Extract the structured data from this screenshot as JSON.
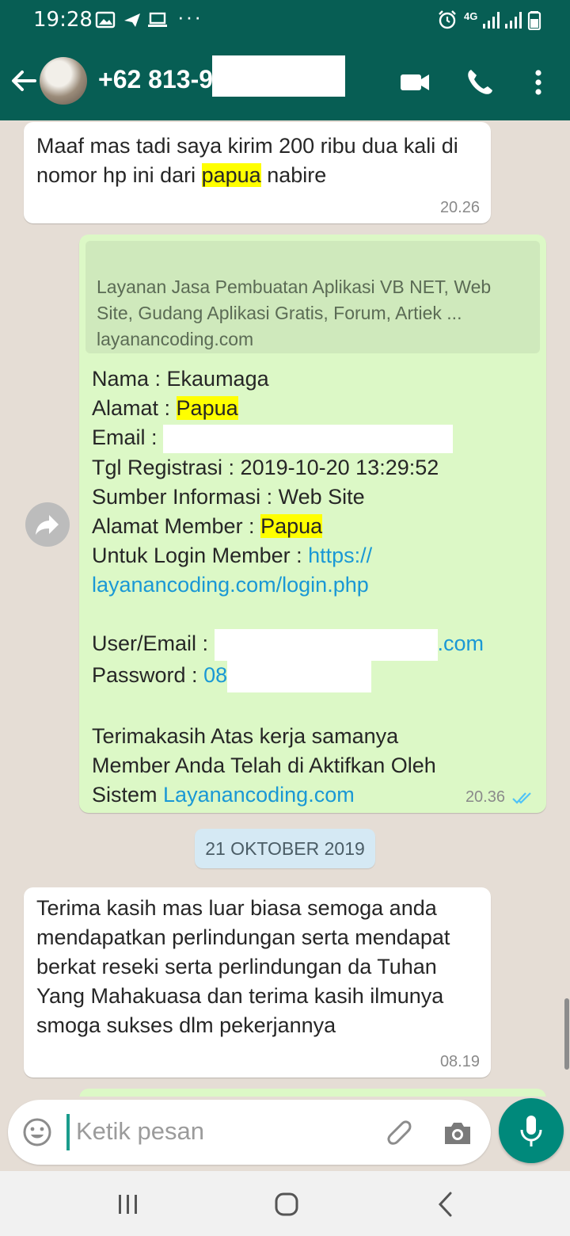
{
  "status_bar": {
    "time": "19:28",
    "more": "···",
    "network": "4G"
  },
  "header": {
    "contact_visible": "+62 813-9",
    "icons": [
      "back-arrow-icon",
      "video-call-icon",
      "voice-call-icon",
      "menu-dots-icon"
    ]
  },
  "messages": [
    {
      "direction": "in",
      "text_pre": "Maaf  mas tadi saya kirim 200 ribu dua kali di nomor hp ini dari ",
      "highlight": "papua",
      "text_post": " nabire",
      "time": "20.26"
    },
    {
      "direction": "out",
      "preview": {
        "title": "Layanan Jasa Pembuatan Aplikasi VB NET, Web Site, Gudang Aplikasi Gratis, Forum, Artiek ...",
        "domain": "layanancoding.com"
      },
      "lines": {
        "nama": "Nama : Ekaumaga",
        "alamat_label": "Alamat : ",
        "alamat_value": "Papua",
        "email_label": "Email : ",
        "tgl": "Tgl Registrasi : 2019-10-20 13:29:52",
        "sumber": "Sumber Informasi : Web Site",
        "alamat_member_label": "Alamat Member : ",
        "alamat_member_value": "Papua",
        "login_label": "Untuk Login Member : ",
        "login_link_1": "https://",
        "login_link_2": "layanancoding.com/login.php",
        "user_label": "User/Email : ",
        "user_suffix": ".com",
        "password_label": "Password : ",
        "password_prefix": "08",
        "thanks_1": "Terimakasih Atas kerja samanya",
        "thanks_2": "Member Anda Telah di Aktifkan Oleh",
        "thanks_3_prefix": "Sistem ",
        "thanks_3_link": "Layanancoding.com"
      },
      "time": "20.36",
      "status": "read"
    },
    {
      "direction": "in",
      "text": "Terima kasih mas luar biasa semoga anda mendapatkan perlindungan serta mendapat berkat reseki serta perlindungan da Tuhan Yang Mahakuasa dan terima kasih ilmunya smoga sukses dlm pekerjannya",
      "time": "08.19"
    }
  ],
  "date_separator": "21 OKTOBER 2019",
  "composer": {
    "placeholder": "Ketik pesan"
  },
  "colors": {
    "header": "#075e54",
    "chat_bg": "#e5ddd5",
    "outgoing": "#dcf8c6",
    "incoming": "#ffffff",
    "link": "#1a98d5",
    "highlight": "#ffff00",
    "mic": "#00897b"
  }
}
